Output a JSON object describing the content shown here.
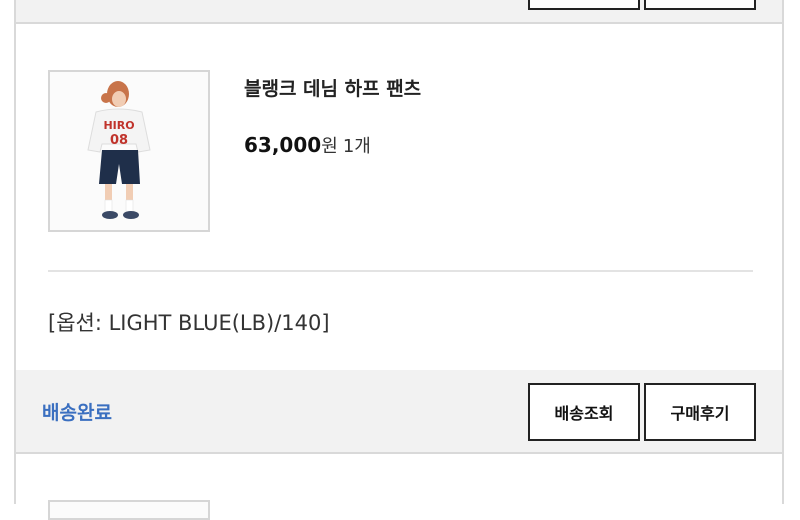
{
  "order_item": {
    "product_name": "블랭크 데님 하프 팬츠",
    "price": "63,000",
    "price_unit": "원",
    "quantity": "1",
    "quantity_unit": "개",
    "option": "[옵션: LIGHT BLUE(LB)/140]",
    "thumbnail_icon": "product-photo-icon",
    "thumbnail_print": [
      "HIRO",
      "08"
    ]
  },
  "footer": {
    "status": "배송완료",
    "track_button": "배송조회",
    "review_button": "구매후기"
  },
  "colors": {
    "status": "#3a6fc0",
    "footer_bg": "#f2f2f2",
    "border": "#d9d9d9"
  }
}
